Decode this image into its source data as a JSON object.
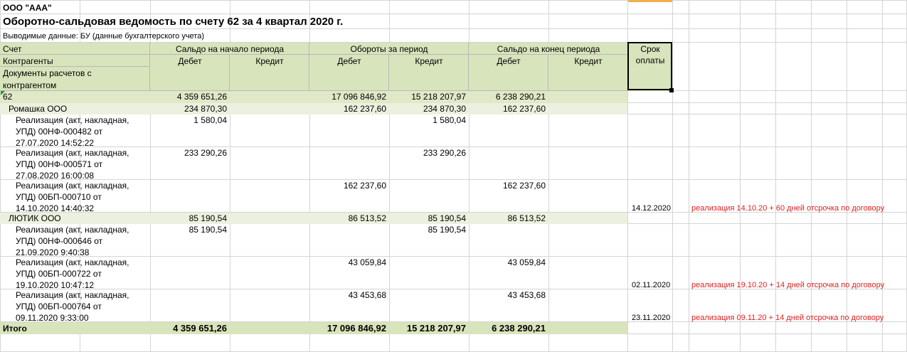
{
  "org": "ООО \"ААА\"",
  "title": "Оборотно-сальдовая ведомость по счету 62 за 4 квартал 2020 г.",
  "output_data": "Выводимые данные:  БУ (данные бухгалтерского учета)",
  "header": {
    "account": "Счет",
    "counterparties": "Контрагенты",
    "docs_line1": "Документы расчетов с",
    "docs_line2": "контрагентом",
    "opening": "Сальдо на начало периода",
    "turnover": "Обороты за период",
    "closing": "Сальдо на конец периода",
    "debit": "Дебет",
    "credit": "Кредит",
    "term_line1": "Срок",
    "term_line2": "оплаты"
  },
  "account_row": {
    "name": "62",
    "open_debit": "4 359 651,26",
    "turn_debit": "17 096 846,92",
    "turn_credit": "15 218 207,97",
    "close_debit": "6 238 290,21"
  },
  "groups": [
    {
      "name": "Ромашка ООО",
      "open_debit": "234 870,30",
      "turn_debit": "162 237,60",
      "turn_credit": "234 870,30",
      "close_debit": "162 237,60",
      "docs": [
        {
          "l1": "Реализация (акт, накладная,",
          "l2": "УПД) 00НФ-000482 от",
          "l3": "27.07.2020 14:52:22",
          "open_debit": "1 580,04",
          "turn_debit": "",
          "turn_credit": "1 580,04",
          "close_debit": "",
          "term": "",
          "note": ""
        },
        {
          "l1": "Реализация (акт, накладная,",
          "l2": "УПД) 00НФ-000571 от",
          "l3": "27.08.2020 16:00:08",
          "open_debit": "233 290,26",
          "turn_debit": "",
          "turn_credit": "233 290,26",
          "close_debit": "",
          "term": "",
          "note": ""
        },
        {
          "l1": "Реализация (акт, накладная,",
          "l2": "УПД) 00БП-000710 от",
          "l3": "14.10.2020 14:40:32",
          "open_debit": "",
          "turn_debit": "162 237,60",
          "turn_credit": "",
          "close_debit": "162 237,60",
          "term": "14.12.2020",
          "note": "реализация 14.10.20 + 60 дней отсрочка по договору"
        }
      ]
    },
    {
      "name": "ЛЮТИК ООО",
      "open_debit": "85 190,54",
      "turn_debit": "86 513,52",
      "turn_credit": "85 190,54",
      "close_debit": "86 513,52",
      "docs": [
        {
          "l1": "Реализация (акт, накладная,",
          "l2": "УПД) 00НФ-000646 от",
          "l3": "21.09.2020 9:40:38",
          "open_debit": "85 190,54",
          "turn_debit": "",
          "turn_credit": "85 190,54",
          "close_debit": "",
          "term": "",
          "note": ""
        },
        {
          "l1": "Реализация (акт, накладная,",
          "l2": "УПД) 00БП-000722 от",
          "l3": "19.10.2020 10:47:12",
          "open_debit": "",
          "turn_debit": "43 059,84",
          "turn_credit": "",
          "close_debit": "43 059,84",
          "term": "02.11.2020",
          "note": "реализация 19.10.20 + 14 дней отсрочка по договору"
        },
        {
          "l1": "Реализация (акт, накладная,",
          "l2": "УПД) 00БП-000764 от",
          "l3": "09.11.2020 9:33:00",
          "open_debit": "",
          "turn_debit": "43 453,68",
          "turn_credit": "",
          "close_debit": "43 453,68",
          "term": "23.11.2020",
          "note": "реализация 09.11.20 + 14 дней отсрочка по договору"
        }
      ]
    }
  ],
  "total": {
    "label": "Итого",
    "open_debit": "4 359 651,26",
    "turn_debit": "17 096 846,92",
    "turn_credit": "15 218 207,97",
    "close_debit": "6 238 290,21"
  },
  "colors": {
    "header_green": "#d8e4bc",
    "note_red": "#e02020",
    "selection": "#000000"
  }
}
